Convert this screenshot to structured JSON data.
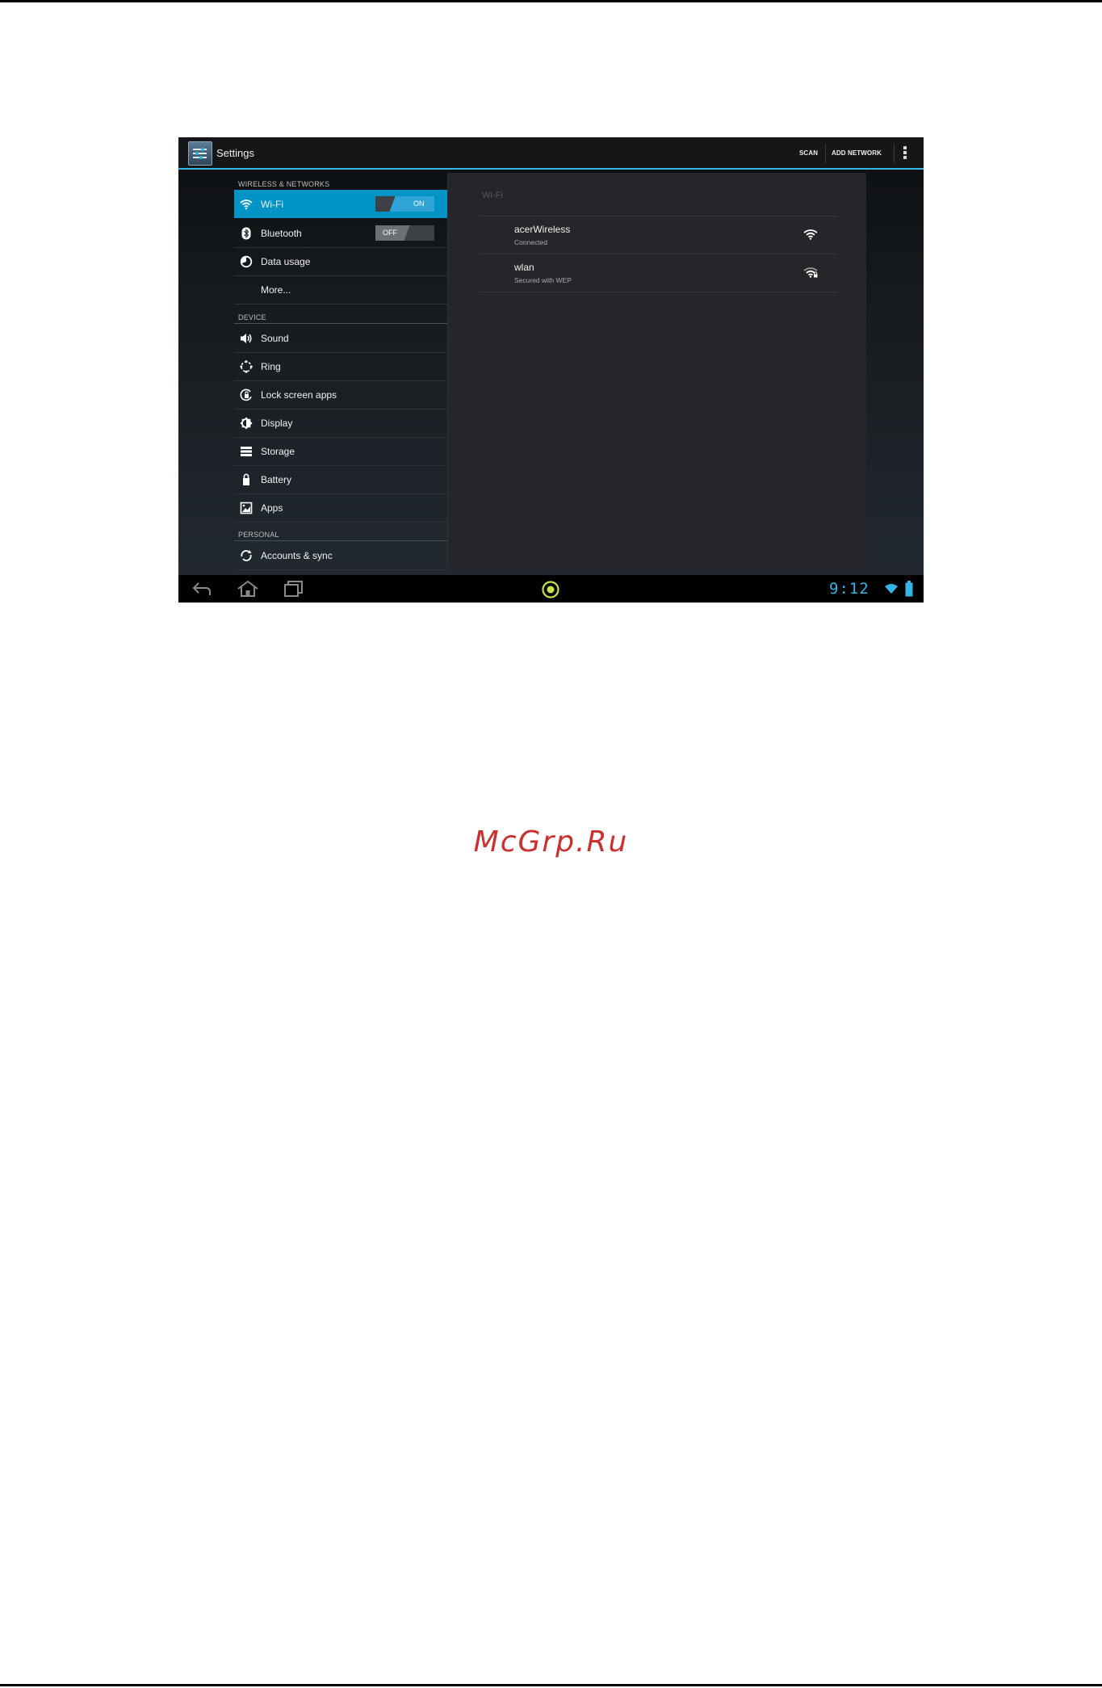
{
  "app": {
    "title": "Settings",
    "actions": {
      "scan": "SCAN",
      "add_network": "ADD NETWORK"
    },
    "accent_color": "#33b5e5"
  },
  "sidebar": {
    "categories": [
      "WIRELESS & NETWORKS",
      "DEVICE",
      "PERSONAL"
    ],
    "items": [
      {
        "label": "Wi-Fi",
        "icon": "wifi-icon",
        "toggle": "ON",
        "selected": true
      },
      {
        "label": "Bluetooth",
        "icon": "bluetooth-icon",
        "toggle": "OFF"
      },
      {
        "label": "Data usage",
        "icon": "data-usage-icon"
      },
      {
        "label": "More...",
        "icon": ""
      },
      {
        "label": "Sound",
        "icon": "speaker-icon"
      },
      {
        "label": "Ring",
        "icon": "ring-icon"
      },
      {
        "label": "Lock screen apps",
        "icon": "lock-screen-icon"
      },
      {
        "label": "Display",
        "icon": "brightness-icon"
      },
      {
        "label": "Storage",
        "icon": "storage-icon"
      },
      {
        "label": "Battery",
        "icon": "battery-icon"
      },
      {
        "label": "Apps",
        "icon": "apps-icon"
      },
      {
        "label": "Accounts & sync",
        "icon": "sync-icon"
      }
    ]
  },
  "wifi_panel": {
    "title": "Wi-Fi",
    "networks": [
      {
        "ssid": "acerWireless",
        "status": "Connected",
        "icon": "wifi-signal-icon"
      },
      {
        "ssid": "wlan",
        "status": "Secured with WEP",
        "icon": "wifi-locked-icon"
      }
    ]
  },
  "system_bar": {
    "clock": "9:12",
    "icons": [
      "back-icon",
      "home-icon",
      "recent-apps-icon",
      "launcher-icon",
      "wifi-status-icon",
      "battery-status-icon"
    ]
  },
  "watermark": "McGrp.Ru"
}
